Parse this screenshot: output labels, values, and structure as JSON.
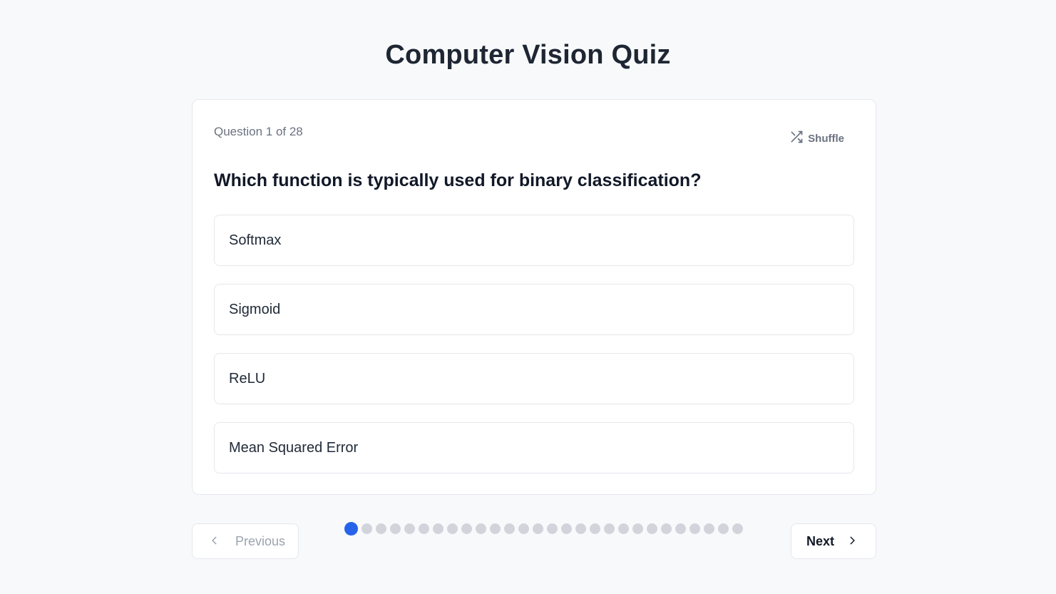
{
  "title": "Computer Vision Quiz",
  "progress": {
    "label": "Question 1 of 28",
    "current": 1,
    "total": 28
  },
  "shuffle_label": "Shuffle",
  "question": "Which function is typically used for binary classification?",
  "options": [
    "Softmax",
    "Sigmoid",
    "ReLU",
    "Mean Squared Error"
  ],
  "nav": {
    "previous_label": "Previous",
    "next_label": "Next"
  },
  "colors": {
    "accent": "#2563eb",
    "dot_inactive": "#d1d5db"
  },
  "icons": {
    "shuffle": "shuffle-icon",
    "previous": "chevron-left-icon",
    "next": "chevron-right-icon"
  }
}
